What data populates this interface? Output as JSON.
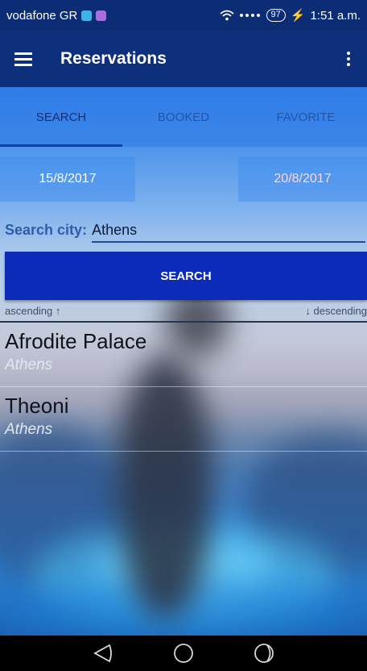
{
  "status_bar": {
    "carrier": "vodafone GR",
    "battery": "97",
    "time": "1:51 a.m."
  },
  "app_bar": {
    "title": "Reservations"
  },
  "tabs": [
    {
      "label": "SEARCH",
      "active": true
    },
    {
      "label": "BOOKED",
      "active": false
    },
    {
      "label": "FAVORITE",
      "active": false
    }
  ],
  "dates": {
    "start": "15/8/2017",
    "end": "20/8/2017"
  },
  "search": {
    "city_label": "Search city:",
    "city_value": "Athens",
    "button_label": "SEARCH"
  },
  "sort": {
    "ascending": "ascending ↑",
    "descending": "↓ descending"
  },
  "results": [
    {
      "name": "Afrodite Palace",
      "city": "Athens"
    },
    {
      "name": "Theoni",
      "city": "Athens"
    }
  ],
  "colors": {
    "app_bar": "#0d2f7c",
    "search_button": "#0b2bb8",
    "tab_indicator": "#1540a0"
  }
}
